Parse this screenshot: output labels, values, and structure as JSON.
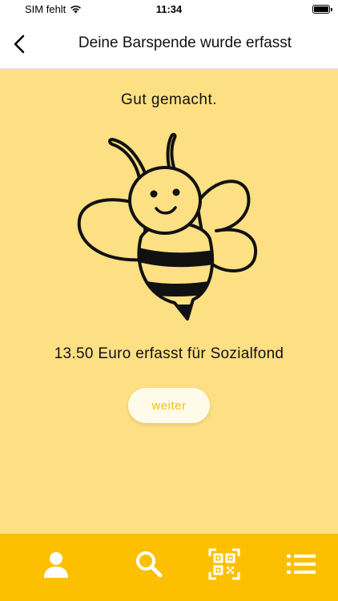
{
  "status_bar": {
    "carrier": "SIM fehlt",
    "time": "11:34"
  },
  "nav": {
    "title": "Deine Barspende wurde erfasst"
  },
  "main": {
    "headline": "Gut gemacht.",
    "amount_text": "13.50 Euro erfasst für Sozialfond",
    "continue_label": "weiter"
  },
  "tab_bar": {
    "items": [
      {
        "icon": "person-icon"
      },
      {
        "icon": "search-icon"
      },
      {
        "icon": "qr-code-icon"
      },
      {
        "icon": "list-icon"
      }
    ]
  },
  "colors": {
    "background": "#fde084",
    "tab_bar": "#fcc000",
    "button_text": "#f3c200"
  }
}
